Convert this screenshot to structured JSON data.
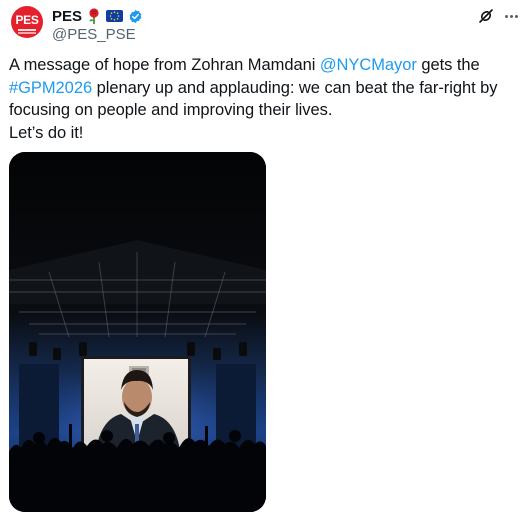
{
  "header": {
    "display_name": "PES",
    "handle": "@PES_PSE",
    "avatar_text": "PES",
    "badge_emojis": [
      "rose-emoji",
      "eu-flag-emoji"
    ],
    "verified_icon": "verified-badge-icon",
    "actions": [
      "grok-icon",
      "more-options-icon"
    ]
  },
  "tweet": {
    "part1": "A message of hope from Zohran Mamdani ",
    "mention": "@NYCMayor",
    "part2": " gets the",
    "hashtag": "#GPM2026",
    "part3": " plenary up and applauding: we can beat the far-right by focusing on people and improving their lives.",
    "part4": "Let’s do it!"
  },
  "media": {
    "type": "photo",
    "description_icon": "concert-stage-photo"
  },
  "colors": {
    "link": "#1d9bf0",
    "brand_red": "#e3202b",
    "secondary_text": "#536471"
  }
}
